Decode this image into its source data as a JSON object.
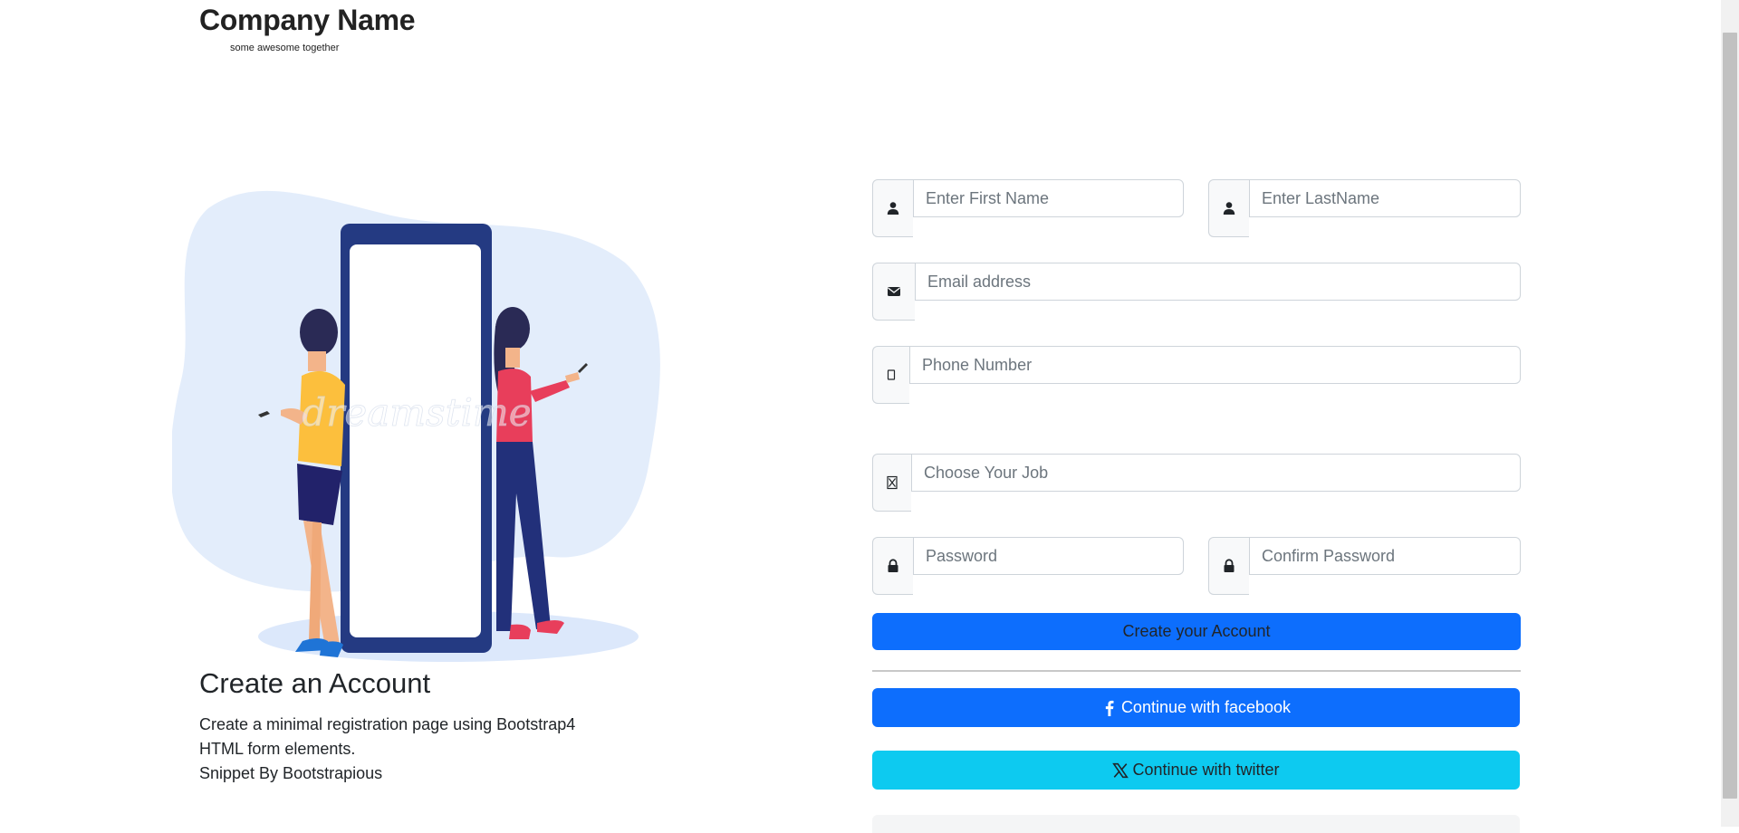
{
  "brand": {
    "company_name": "Company Name",
    "tagline": "some awesome together"
  },
  "illustration": {
    "watermark": "dreamstime"
  },
  "intro": {
    "heading": "Create an Account",
    "line1": "Create a minimal registration page using Bootstrap4",
    "line2": "HTML form elements.",
    "line3": "Snippet By Bootstrapious"
  },
  "form": {
    "first_name_placeholder": "Enter First Name",
    "last_name_placeholder": "Enter LastName",
    "email_placeholder": "Email address",
    "phone_placeholder": "Phone Number",
    "job_placeholder": "Choose Your Job",
    "password_placeholder": "Password",
    "confirm_password_placeholder": "Confirm Password",
    "submit_label": "Create your Account",
    "facebook_label": "Continue with facebook",
    "twitter_label": "Continue with twitter"
  },
  "icons": {
    "first_name": "user-icon",
    "last_name": "user-icon",
    "email": "envelope-icon",
    "phone": "mobile-icon",
    "job": "briefcase-icon",
    "password": "lock-icon",
    "confirm_password": "lock-icon",
    "facebook": "facebook-icon",
    "twitter": "x-twitter-icon"
  },
  "colors": {
    "primary": "#0d6efd",
    "info": "#0dcaf0",
    "illustration_blob": "#e3edfb",
    "phone_frame": "#243a82"
  }
}
